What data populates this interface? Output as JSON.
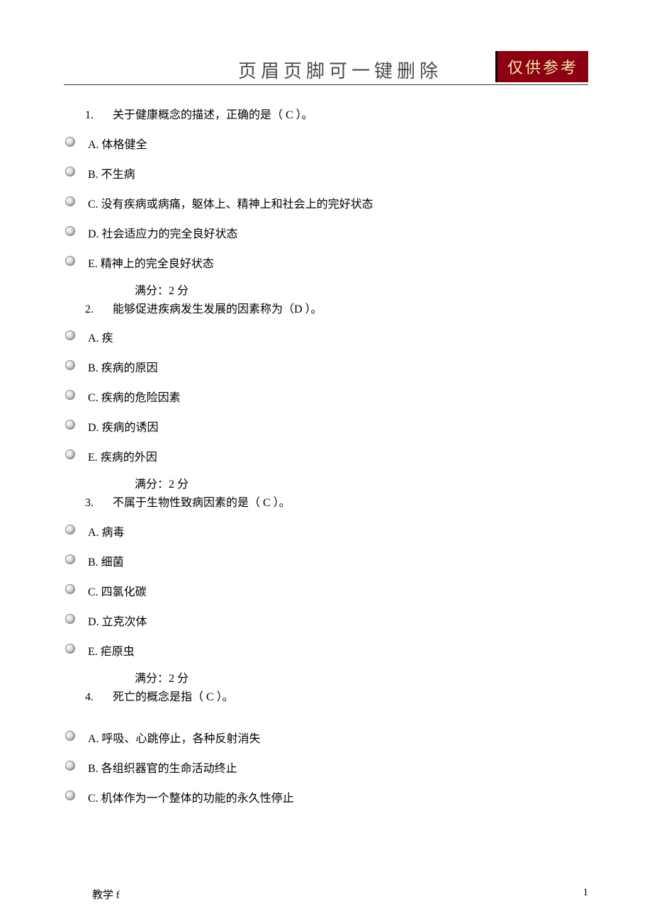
{
  "header": {
    "title": "页眉页脚可一键删除",
    "badge": "仅供参考"
  },
  "questions": [
    {
      "num": "1.",
      "text": "关于健康概念的描述，正确的是（  C ）。",
      "options": [
        "A. 体格健全",
        "B. 不生病",
        "C. 没有疾病或病痛，躯体上、精神上和社会上的完好状态",
        "D. 社会适应力的完全良好状态",
        "E. 精神上的完全良好状态"
      ],
      "score": "满分：2    分"
    },
    {
      "num": "2.",
      "text": "能够促进疾病发生发展的因素称为（D   ）。",
      "options": [
        "A. 疾",
        "B. 疾病的原因",
        "C. 疾病的危险因素",
        "D. 疾病的诱因",
        "E. 疾病的外因"
      ],
      "score": "满分：2    分"
    },
    {
      "num": "3.",
      "text": "不属于生物性致病因素的是（    C ）。",
      "options": [
        "A. 病毒",
        "B. 细菌",
        "C. 四氯化碳",
        "D. 立克次体",
        "E. 疟原虫"
      ],
      "score": "满分：2    分"
    },
    {
      "num": "4.",
      "text": "死亡的概念是指（   C  ）。",
      "options": [
        "A. 呼吸、心跳停止，各种反射消失",
        "B. 各组织器官的生命活动终止",
        "C. 机体作为一个整体的功能的永久性停止"
      ],
      "score": ""
    }
  ],
  "footer": {
    "left": "教学 f",
    "right": "1"
  }
}
